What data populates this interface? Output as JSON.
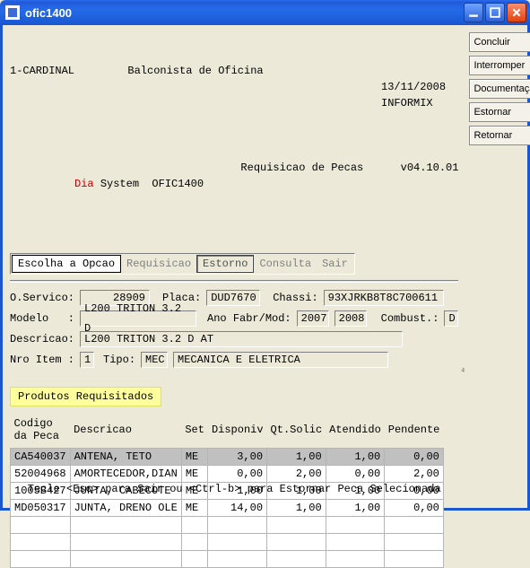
{
  "window": {
    "title": "ofic1400"
  },
  "header": {
    "left1": "1-CARDINAL",
    "center1": "Balconista de Oficina",
    "date": "13/11/2008",
    "db": "INFORMIX",
    "dia": "Dia",
    "system": " System  OFIC1400",
    "center2": "Requisicao de Pecas",
    "version": "v04.10.01"
  },
  "menu": {
    "escolha": "Escolha a Opcao",
    "items": [
      "Requisicao",
      "Estorno",
      "Consulta",
      "Sair"
    ],
    "active_index": 1
  },
  "form": {
    "oservico_label": "O.Servico:",
    "oservico": "     28909",
    "placa_label": "Placa:",
    "placa": "DUD7670",
    "chassi_label": "Chassi:",
    "chassi": "93XJRKB8T8C700611",
    "modelo_label": "Modelo   :",
    "modelo": "L200 TRITON 3.2 D",
    "anofab_label": "Ano Fabr/Mod:",
    "anofab": "2007",
    "anomod": "2008",
    "combust_label": "Combust.:",
    "combust": "D",
    "descricao_label": "Descricao:",
    "descricao": "L200 TRITON 3.2 D AT",
    "nroitem_label": "Nro Item :",
    "nroitem": "1",
    "tipo_label": "Tipo:",
    "tipo": "MEC",
    "tipo_desc": "MECANICA E ELETRICA"
  },
  "products": {
    "title": "Produtos Requisitados",
    "columns": [
      "Codigo da Peca",
      "Descricao",
      "Set",
      "Disponiv",
      "Qt.Solic",
      "Atendido",
      "Pendente"
    ],
    "rows": [
      {
        "codigo": "CA540037",
        "descricao": "ANTENA, TETO",
        "set": "ME",
        "disponiv": "3,00",
        "qtsolic": "1,00",
        "atendido": "1,00",
        "pendente": "0,00",
        "selected": true
      },
      {
        "codigo": "52004968",
        "descricao": "AMORTECEDOR,DIAN",
        "set": "ME",
        "disponiv": "0,00",
        "qtsolic": "2,00",
        "atendido": "0,00",
        "pendente": "2,00",
        "selected": false
      },
      {
        "codigo": "1005B427",
        "descricao": "JUNTA, CABECOTE",
        "set": "ME",
        "disponiv": "1,00",
        "qtsolic": "1,00",
        "atendido": "1,00",
        "pendente": "0,00",
        "selected": false
      },
      {
        "codigo": "MD050317",
        "descricao": "JUNTA, DRENO OLE",
        "set": "ME",
        "disponiv": "14,00",
        "qtsolic": "1,00",
        "atendido": "1,00",
        "pendente": "0,00",
        "selected": false
      }
    ],
    "empty_rows": 3
  },
  "side_buttons": [
    "Concluir",
    "Interromper",
    "Documentação",
    "Estornar",
    "Retornar"
  ],
  "footer": "Tecle <Esc> para Sair ou <Ctrl-b> para Estornar Peca Selecionada",
  "scroll_marker": "⁴"
}
